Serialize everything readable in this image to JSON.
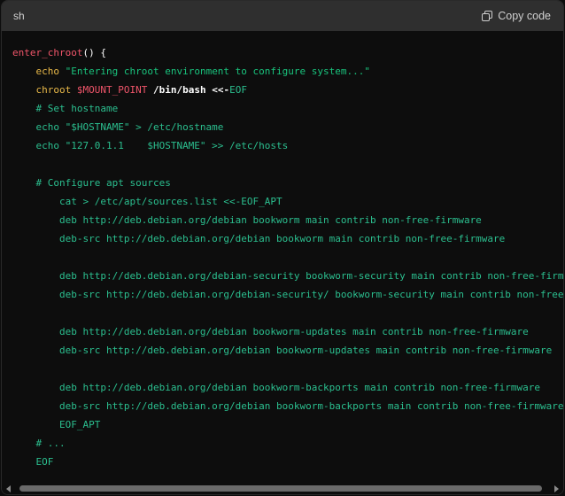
{
  "header": {
    "language": "sh",
    "copy_label": "Copy code",
    "copy_icon": "copy-icon"
  },
  "code": {
    "l1_fn": "enter_chroot",
    "l1_rest": "() {",
    "l2_kw": "echo",
    "l2_str": "\"Entering chroot environment to configure system...\"",
    "l3_kw": "chroot",
    "l3_var": "$MOUNT_POINT",
    "l3_path": "/bin/bash",
    "l3_op": "<<-",
    "l3_eof": "EOF",
    "l4": "# Set hostname",
    "l5": "echo \"$HOSTNAME\" > /etc/hostname",
    "l6": "echo \"127.0.1.1    $HOSTNAME\" >> /etc/hosts",
    "l8": "# Configure apt sources",
    "l9": "cat > /etc/apt/sources.list <<-EOF_APT",
    "l10": "deb http://deb.debian.org/debian bookworm main contrib non-free-firmware",
    "l11": "deb-src http://deb.debian.org/debian bookworm main contrib non-free-firmware",
    "l13": "deb http://deb.debian.org/debian-security bookworm-security main contrib non-free-firmware",
    "l14": "deb-src http://deb.debian.org/debian-security/ bookworm-security main contrib non-free-firmware",
    "l16": "deb http://deb.debian.org/debian bookworm-updates main contrib non-free-firmware",
    "l17": "deb-src http://deb.debian.org/debian bookworm-updates main contrib non-free-firmware",
    "l19": "deb http://deb.debian.org/debian bookworm-backports main contrib non-free-firmware",
    "l20": "deb-src http://deb.debian.org/debian bookworm-backports main contrib non-free-firmware",
    "l21": "EOF_APT",
    "l22": "# ...",
    "l23": "EOF"
  },
  "colors": {
    "background": "#0d0d0d",
    "header": "#2f2f2f",
    "function": "#f0556a",
    "keyword": "#e9b949",
    "string": "#19c37d",
    "comment": "#2bbf8f"
  }
}
